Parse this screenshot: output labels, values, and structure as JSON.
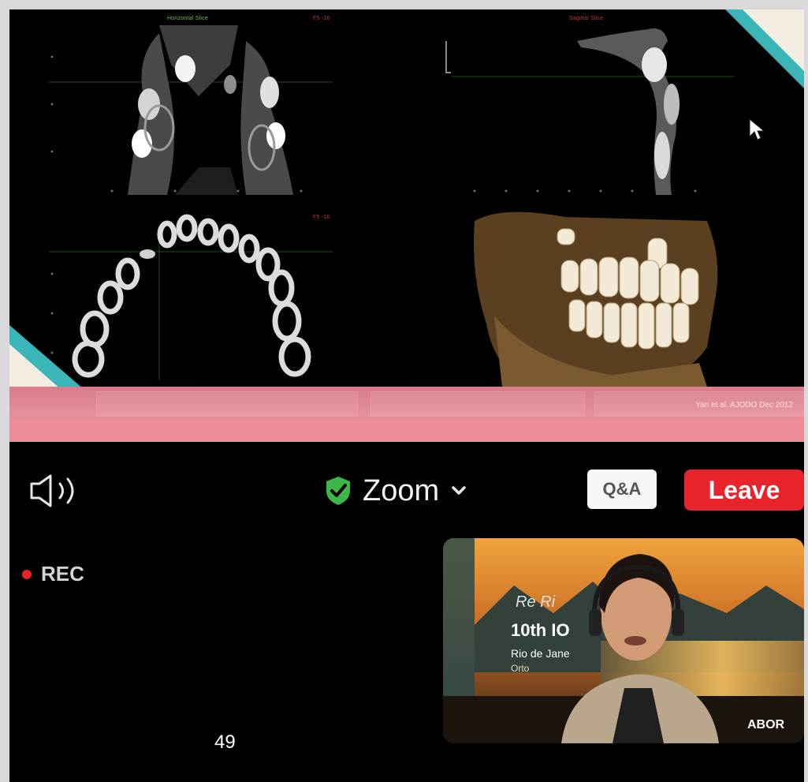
{
  "slide": {
    "citation": "Yan et al. AJODO Dec 2012",
    "panel_labels": {
      "axial_top": "Horizontal Slice",
      "sagittal_top": "Sagittal Slice",
      "axial_top_right": "F5 -16",
      "axial_bottom_right": "F5 -16"
    }
  },
  "toolbar": {
    "title": "Zoom",
    "qa_label": "Q&A",
    "leave_label": "Leave"
  },
  "recording": {
    "label": "REC"
  },
  "page": {
    "number": "49"
  },
  "speaker_video": {
    "banner_script": "Re Ri",
    "banner_edition": "10th IO",
    "banner_location": "Rio de Jane",
    "banner_sub": "Orto",
    "logo_text": "ABOR"
  },
  "colors": {
    "leave": "#e8232b",
    "shield": "#3cb54a",
    "footer_pink": "#e48f9b",
    "corner_teal": "#3bb6b8",
    "rec_dot": "#e8232b"
  }
}
